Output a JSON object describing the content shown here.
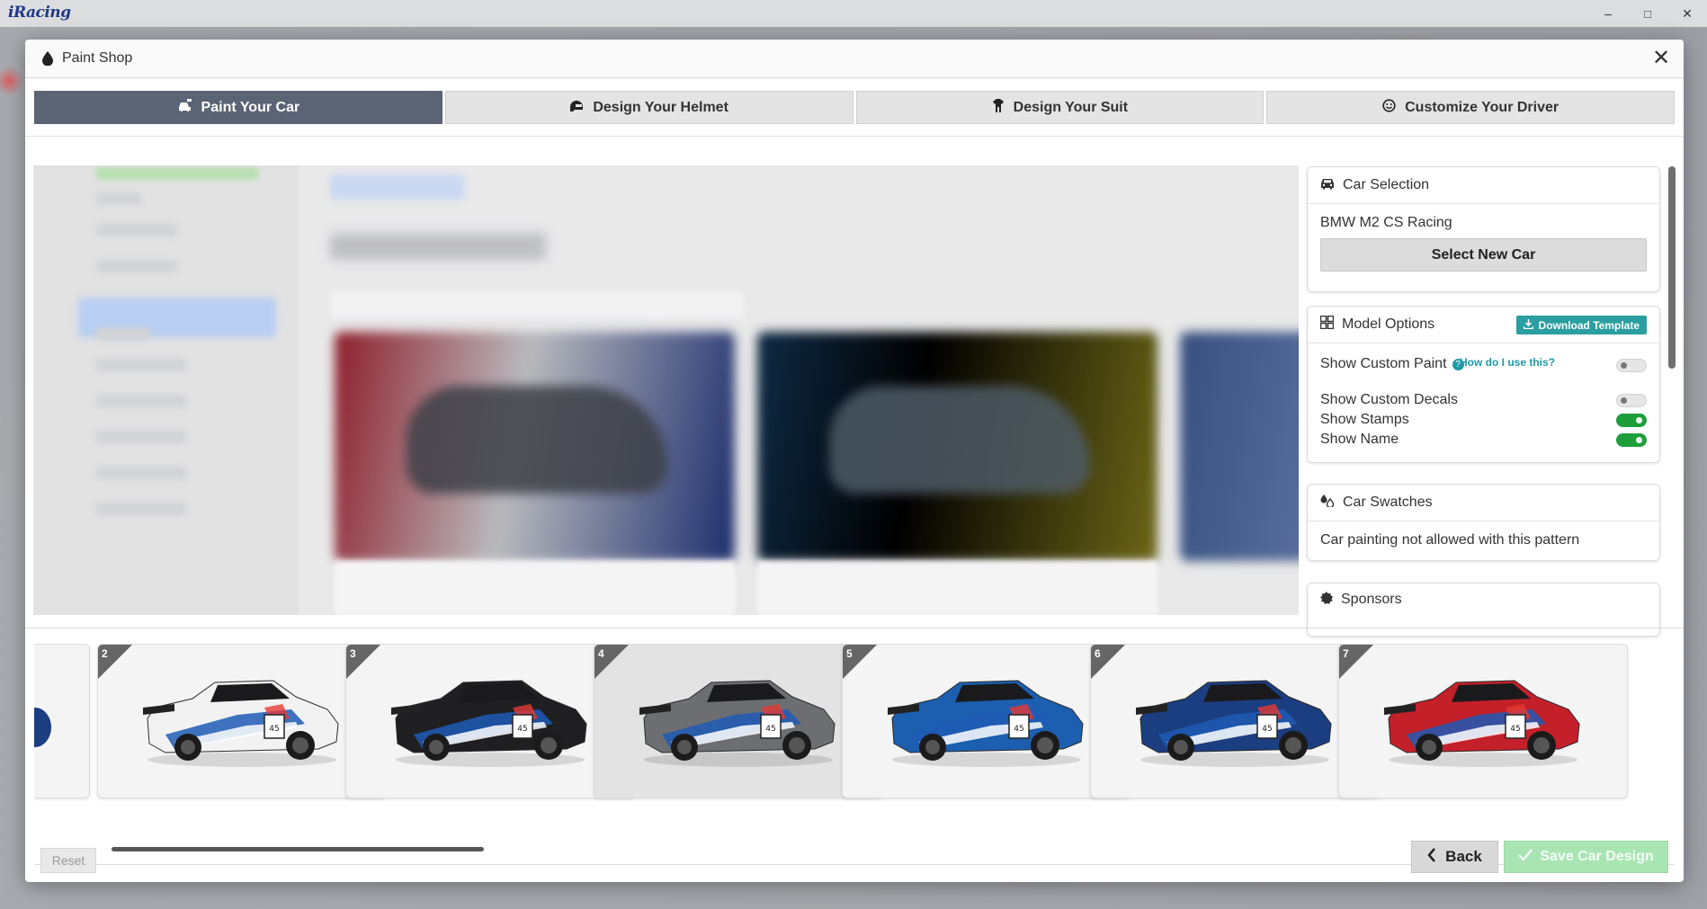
{
  "app": {
    "brand": "iRacing"
  },
  "window_controls": {
    "minimize": "–",
    "maximize": "□",
    "close": "✕"
  },
  "modal": {
    "title": "Paint Shop",
    "close_glyph": "✕"
  },
  "tabs": [
    {
      "label": "Paint Your Car",
      "icon": "car-paint-icon",
      "active": true
    },
    {
      "label": "Design Your Helmet",
      "icon": "helmet-icon",
      "active": false
    },
    {
      "label": "Design Your Suit",
      "icon": "suit-icon",
      "active": false
    },
    {
      "label": "Customize Your Driver",
      "icon": "smiley-icon",
      "active": false
    }
  ],
  "car_selection": {
    "title": "Car Selection",
    "car_name": "BMW M2 CS Racing",
    "select_button": "Select New Car"
  },
  "model_options": {
    "title": "Model Options",
    "download_button": "Download Template",
    "help_link": "How do I use this?",
    "options": [
      {
        "label": "Show Custom Paint",
        "on": false
      },
      {
        "label": "Show Custom Decals",
        "on": false
      },
      {
        "label": "Show Stamps",
        "on": true
      },
      {
        "label": "Show Name",
        "on": true
      }
    ]
  },
  "car_swatches": {
    "title": "Car Swatches",
    "message": "Car painting not allowed with this pattern"
  },
  "sponsors": {
    "title": "Sponsors"
  },
  "patterns": [
    {
      "number": "2",
      "body": "#f2f2f2",
      "active": false
    },
    {
      "number": "3",
      "body": "#1f1f22",
      "active": false
    },
    {
      "number": "4",
      "body": "#6c6e72",
      "active": true
    },
    {
      "number": "5",
      "body": "#1c5fb0",
      "active": false
    },
    {
      "number": "6",
      "body": "#1b3e80",
      "active": false
    },
    {
      "number": "7",
      "body": "#c4202a",
      "active": false
    }
  ],
  "footer": {
    "reset": "Reset",
    "back": "Back",
    "save": "Save Car Design"
  },
  "colors": {
    "active_tab": "#5b6475",
    "teal": "#2a9ea0",
    "toggle_on": "#1e9e3b",
    "save_disabled": "#a9e5b3"
  }
}
